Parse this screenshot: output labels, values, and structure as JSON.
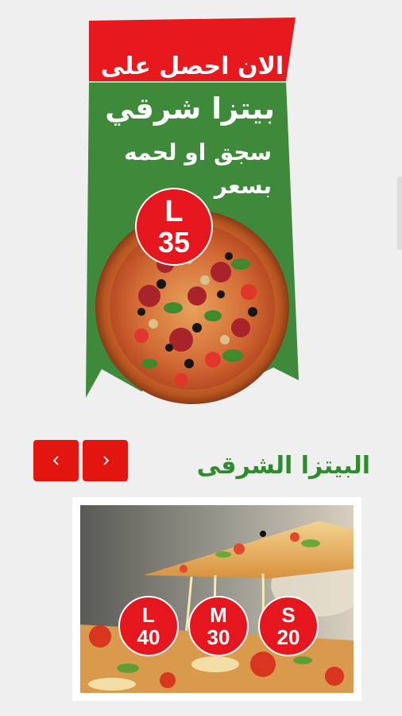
{
  "promo": {
    "header": "الان احصل على",
    "line1": "بيتزا شرقي",
    "line2": "سجق او لحمه",
    "line3": "بسعر",
    "badge": {
      "size": "L",
      "price": "35"
    }
  },
  "navigation": {
    "prev_icon": "chevron-left-icon",
    "next_icon": "chevron-right-icon"
  },
  "product": {
    "title": "البيتزا الشرقى",
    "prices": [
      {
        "size": "L",
        "price": "40"
      },
      {
        "size": "M",
        "price": "30"
      },
      {
        "size": "S",
        "price": "20"
      }
    ]
  },
  "colors": {
    "red": "#e5161e",
    "green": "#3f8a3a",
    "title_green": "#2e8b2e",
    "background": "#efefef"
  }
}
